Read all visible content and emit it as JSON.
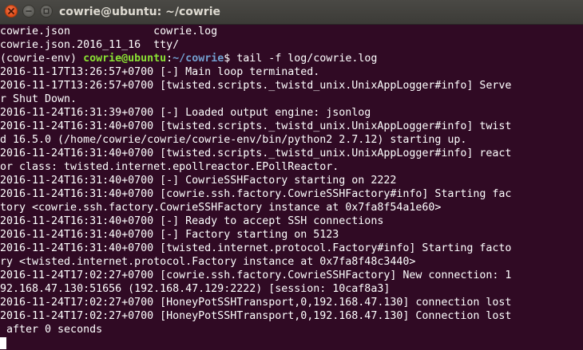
{
  "window": {
    "title": "cowrie@ubuntu: ~/cowrie"
  },
  "icons": {
    "close": "close-icon",
    "minimize": "minimize-icon",
    "maximize": "maximize-icon"
  },
  "colors": {
    "background": "#300a24",
    "text": "#ffffff",
    "prompt_user": "#8ae234",
    "prompt_path": "#729fcf",
    "close_button": "#df4a16"
  },
  "terminal": {
    "ls_output": [
      "cowrie.json             cowrie.log",
      "cowrie.json.2016_11_16  tty/"
    ],
    "prompt": {
      "env": "(cowrie-env) ",
      "userhost": "cowrie@ubuntu",
      "sep": ":",
      "path": "~/cowrie",
      "dollar": "$ ",
      "command": "tail -f log/cowrie.log"
    },
    "log_lines": [
      "2016-11-17T13:26:57+0700 [-] Main loop terminated.",
      "2016-11-17T13:26:57+0700 [twisted.scripts._twistd_unix.UnixAppLogger#info] Serve",
      "r Shut Down.",
      "2016-11-24T16:31:39+0700 [-] Loaded output engine: jsonlog",
      "2016-11-24T16:31:40+0700 [twisted.scripts._twistd_unix.UnixAppLogger#info] twist",
      "d 16.5.0 (/home/cowrie/cowrie/cowrie-env/bin/python2 2.7.12) starting up.",
      "2016-11-24T16:31:40+0700 [twisted.scripts._twistd_unix.UnixAppLogger#info] react",
      "or class: twisted.internet.epollreactor.EPollReactor.",
      "2016-11-24T16:31:40+0700 [-] CowrieSSHFactory starting on 2222",
      "2016-11-24T16:31:40+0700 [cowrie.ssh.factory.CowrieSSHFactory#info] Starting fac",
      "tory <cowrie.ssh.factory.CowrieSSHFactory instance at 0x7fa8f54a1e60>",
      "2016-11-24T16:31:40+0700 [-] Ready to accept SSH connections",
      "2016-11-24T16:31:40+0700 [-] Factory starting on 5123",
      "2016-11-24T16:31:40+0700 [twisted.internet.protocol.Factory#info] Starting facto",
      "ry <twisted.internet.protocol.Factory instance at 0x7fa8f48c3440>",
      "2016-11-24T17:02:27+0700 [cowrie.ssh.factory.CowrieSSHFactory] New connection: 1",
      "92.168.47.130:51656 (192.168.47.129:2222) [session: 10caf8a3]",
      "2016-11-24T17:02:27+0700 [HoneyPotSSHTransport,0,192.168.47.130] connection lost",
      "2016-11-24T17:02:27+0700 [HoneyPotSSHTransport,0,192.168.47.130] Connection lost",
      " after 0 seconds"
    ]
  }
}
